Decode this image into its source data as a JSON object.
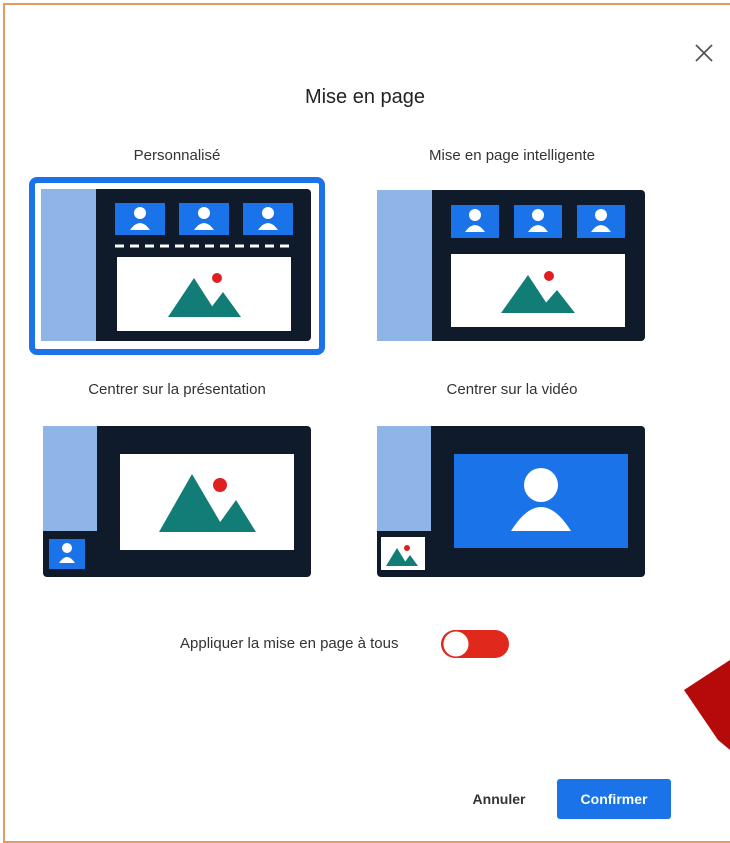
{
  "dialog": {
    "title": "Mise en page",
    "options": [
      {
        "label": "Personnalisé",
        "selected": true
      },
      {
        "label": "Mise en page intelligente",
        "selected": false
      },
      {
        "label": "Centrer sur la présentation",
        "selected": false
      },
      {
        "label": "Centrer sur la vidéo",
        "selected": false
      }
    ],
    "apply_all_label": "Appliquer la mise en page à tous",
    "apply_all_on": false,
    "cancel_label": "Annuler",
    "confirm_label": "Confirmer"
  },
  "colors": {
    "accent": "#1a73e8",
    "thumb_dark": "#0f1a2a",
    "thumb_sidebar": "#8fb5e6",
    "toggle_on": "#e0281c",
    "teal": "#127d76",
    "red_dot": "#e02020"
  },
  "icons": [
    "close-icon",
    "person-icon",
    "mountain-image-icon"
  ]
}
